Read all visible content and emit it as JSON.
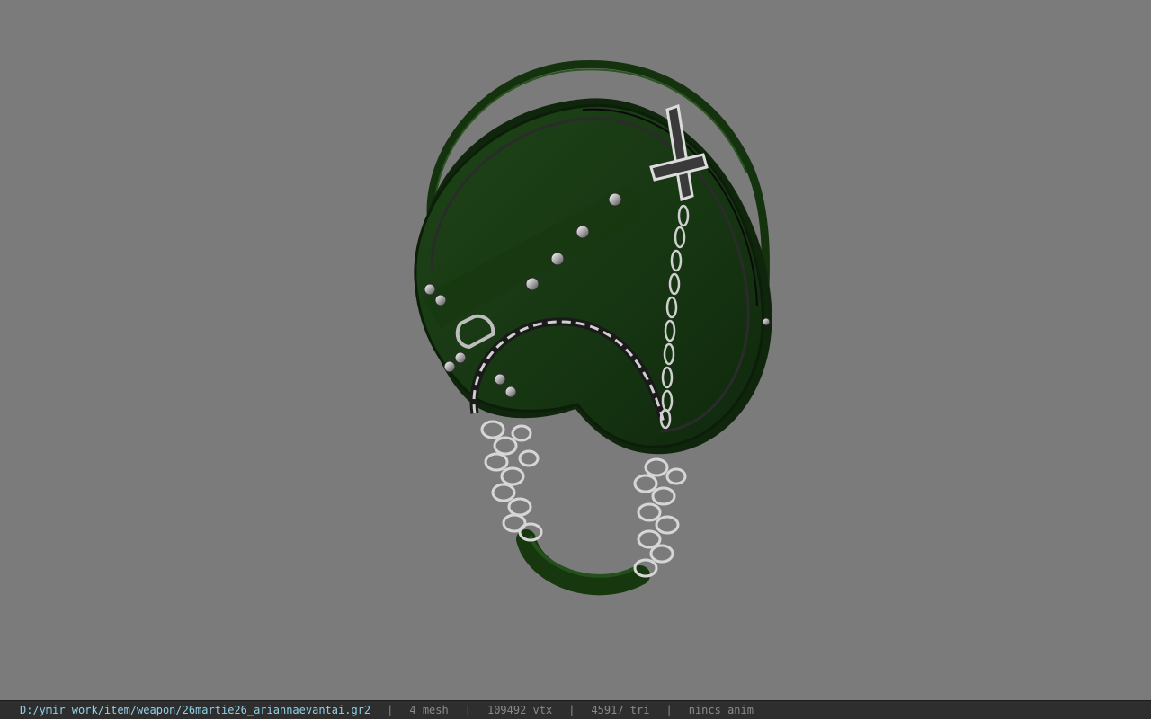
{
  "statusbar": {
    "file_path": "D:/ymir work/item/weapon/26martie26_ariannaevantai.gr2",
    "mesh_count": "4 mesh",
    "vertex_count": "109492 vtx",
    "triangle_count": "45917 tri",
    "anim_status": "nincs anim",
    "separator": "|"
  },
  "colors": {
    "background": "#7b7b7b",
    "statusbar_bg": "#2e2e2e",
    "path_text": "#8fd0e8",
    "stat_text": "#8a8a8a",
    "leather": "#1a3a12",
    "metal": "#c8c8c8"
  }
}
